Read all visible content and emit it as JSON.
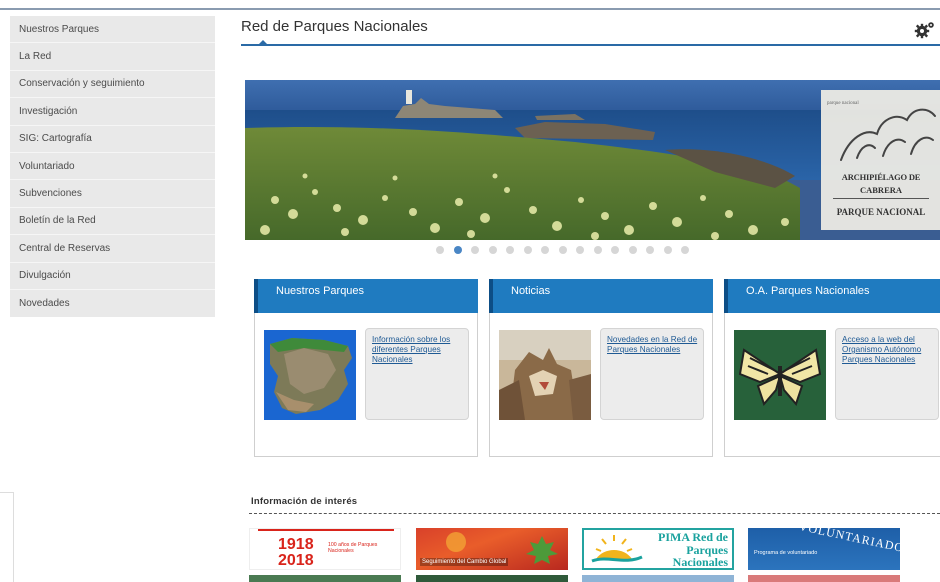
{
  "sidebar": {
    "items": [
      "Nuestros Parques",
      "La Red",
      "Conservación y seguimiento",
      "Investigación",
      "SIG: Cartografía",
      "Voluntariado",
      "Subvenciones",
      "Boletín de la Red",
      "Central de Reservas",
      "Divulgación",
      "Novedades"
    ]
  },
  "header": {
    "title": "Red de Parques Nacionales",
    "settings_icon": "gear-icon"
  },
  "hero": {
    "logo_line1": "ARCHIPIÉLAGO DE",
    "logo_line2": "CABRERA",
    "logo_line3": "PARQUE NACIONAL",
    "slide_count": 15,
    "active_slide": 2
  },
  "cards": [
    {
      "title": "Nuestros Parques",
      "link": "Información sobre los diferentes Parques Nacionales"
    },
    {
      "title": "Noticias",
      "link": "Novedades en la Red de Parques Nacionales"
    },
    {
      "title": "O.A. Parques Nacionales",
      "link": "Acceso a la web del Organismo Autónomo Parques Nacionales"
    }
  ],
  "info": {
    "title": "Información de interés",
    "banners": {
      "centenary_year1": "1918",
      "centenary_year2": "2018",
      "centenary_text": "100 años de Parques Nacionales",
      "seguimiento_text": "Seguimiento del Cambio Global",
      "pima_text": "PIMA Red de Parques Nacionales",
      "voluntariado_arc": "VOLUNTARIADO",
      "voluntariado_text": "Programa de voluntariado"
    }
  },
  "colors": {
    "card_header": "#1f7bc0",
    "title_rule": "#2a6aa6",
    "sidebar_bg": "#e9e9e9",
    "active_dot": "#4a86c5"
  }
}
